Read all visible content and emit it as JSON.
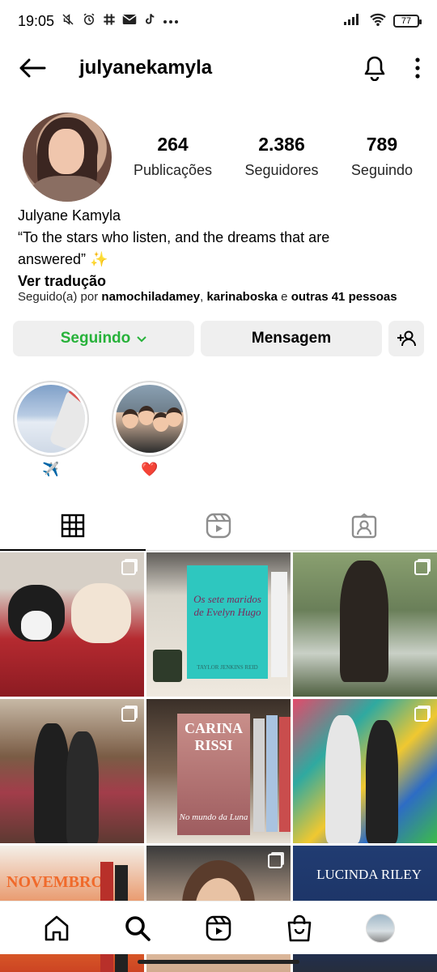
{
  "status_bar": {
    "time": "19:05",
    "left_icons": [
      "mute-icon",
      "alarm-icon",
      "slack-icon",
      "mail-icon",
      "tiktok-icon",
      "more-dots-icon"
    ],
    "battery": "77"
  },
  "header": {
    "username": "julyanekamyla"
  },
  "profile": {
    "stats": [
      {
        "value": "264",
        "label": "Publicações"
      },
      {
        "value": "2.386",
        "label": "Seguidores"
      },
      {
        "value": "789",
        "label": "Seguindo"
      }
    ],
    "name": "Julyane Kamyla",
    "bio_line1": "“To the stars who listen, and the dreams that are",
    "bio_line2": "answered” ✨",
    "translate": "Ver tradução",
    "followed_prefix": "Seguido(a) por ",
    "followed_user1": "namochiladamey",
    "followed_sep": ", ",
    "followed_user2": "karinaboska",
    "followed_and": " e ",
    "followed_others": "outras 41 pessoas"
  },
  "buttons": {
    "following": "Seguindo",
    "message": "Mensagem"
  },
  "highlights": [
    {
      "label": "✈️"
    },
    {
      "label": "❤️"
    }
  ],
  "tabs": [
    "grid-icon",
    "reels-icon",
    "tagged-icon"
  ],
  "grid_texts": {
    "book1": "Os sete maridos de Evelyn Hugo",
    "book1_author": "TAYLOR JENKINS REID",
    "book2_author": "CARINA RISSI",
    "book2_title": "No mundo da Luna",
    "book3_title": "NOVEMBRO,",
    "book4_author": "LUCINDA RILEY"
  },
  "bottom_nav": [
    "home-icon",
    "search-icon",
    "reels-icon",
    "shop-icon",
    "profile-avatar"
  ]
}
